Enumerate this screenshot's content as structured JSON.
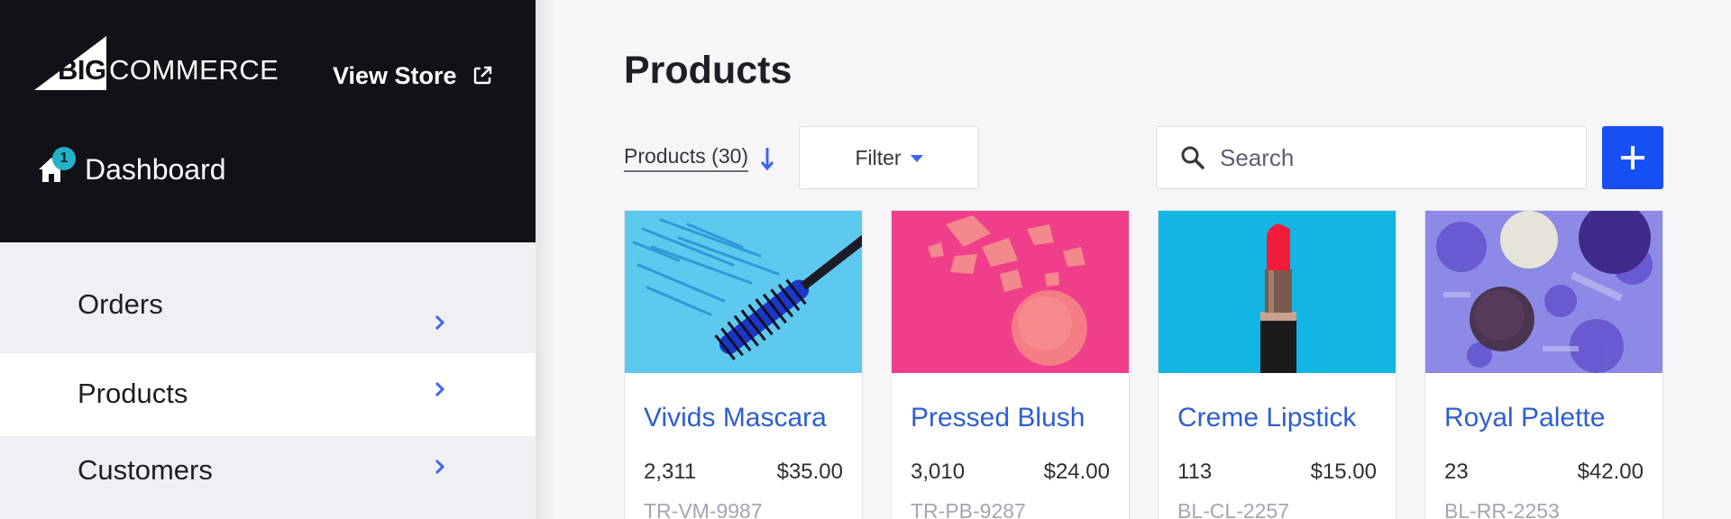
{
  "brand": {
    "logo_big": "BIG",
    "logo_commerce": "COMMERCE"
  },
  "header": {
    "view_store": "View Store"
  },
  "dashboard": {
    "label": "Dashboard",
    "badge": "1"
  },
  "nav": {
    "items": [
      {
        "label": "Orders",
        "active": false
      },
      {
        "label": "Products",
        "active": true
      },
      {
        "label": "Customers",
        "active": false
      }
    ]
  },
  "main": {
    "title": "Products",
    "sort_label": "Products (30)",
    "filter_label": "Filter",
    "search_placeholder": "Search"
  },
  "products": [
    {
      "name": "Vivids Mascara",
      "quantity": "2,311",
      "price": "$35.00",
      "sku": "TR-VM-9987",
      "image": "mascara"
    },
    {
      "name": "Pressed Blush",
      "quantity": "3,010",
      "price": "$24.00",
      "sku": "TR-PB-9287",
      "image": "blush"
    },
    {
      "name": "Creme Lipstick",
      "quantity": "113",
      "price": "$15.00",
      "sku": "BL-CL-2257",
      "image": "lipstick"
    },
    {
      "name": "Royal Palette",
      "quantity": "23",
      "price": "$42.00",
      "sku": "BL-RR-2253",
      "image": "palette"
    }
  ],
  "colors": {
    "sidebar_header": "#121118",
    "accent_blue": "#1650f5",
    "link_blue": "#2e5ecf",
    "badge_teal": "#22b4c6"
  },
  "icons": [
    "logo-triangle",
    "external-link-icon",
    "home-icon",
    "chevron-right-icon",
    "arrow-down-icon",
    "caret-down-icon",
    "search-icon",
    "plus-icon"
  ]
}
